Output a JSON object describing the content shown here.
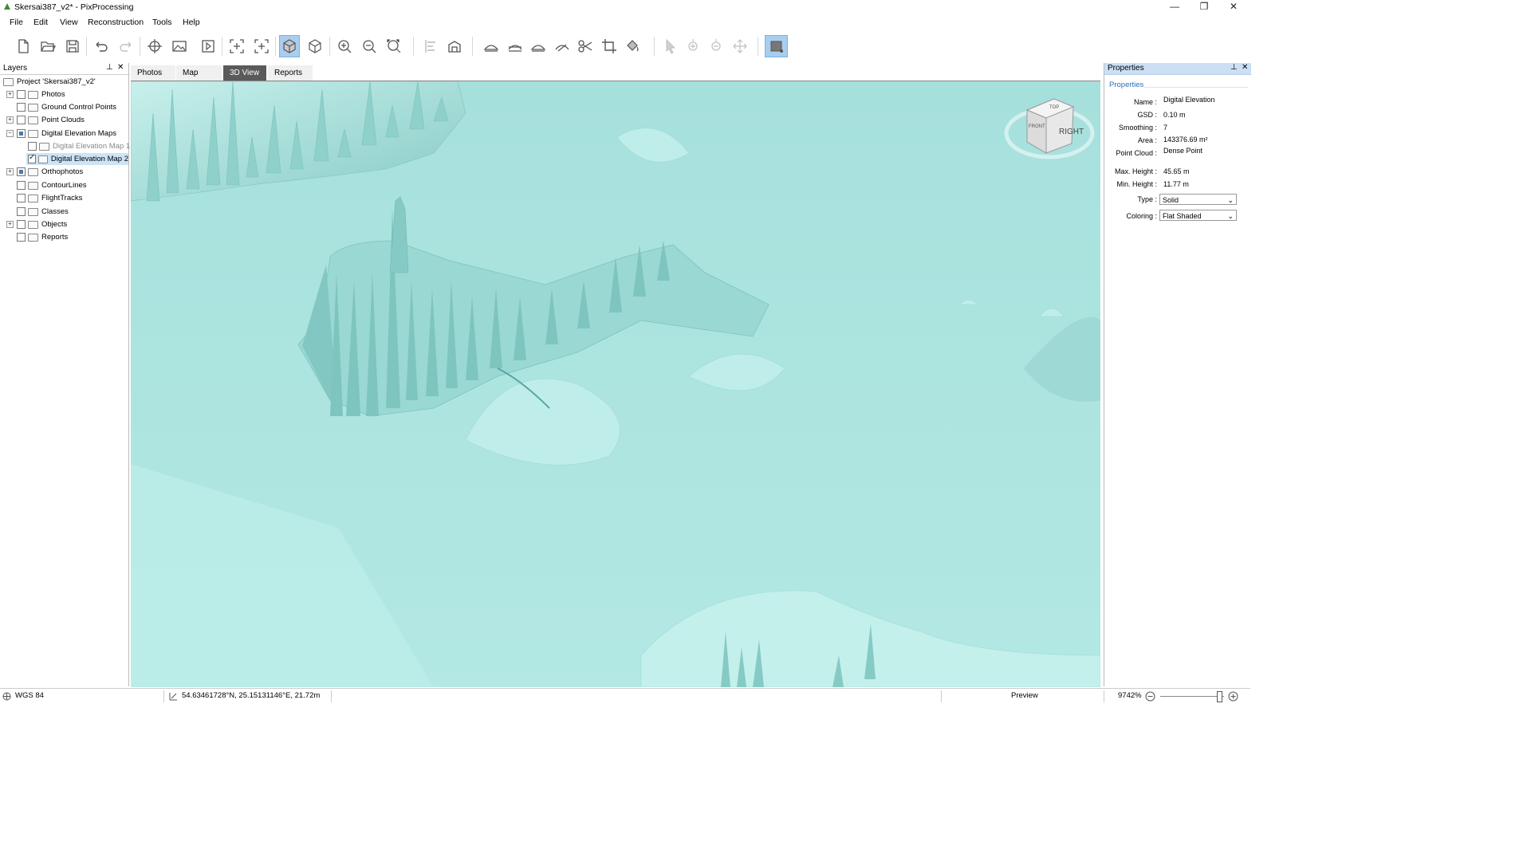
{
  "window": {
    "title": "Skersai387_v2* - PixProcessing",
    "minimize": "—",
    "maximize": "❐",
    "close": "✕"
  },
  "menu": [
    "File",
    "Edit",
    "View",
    "Reconstruction",
    "Tools",
    "Help"
  ],
  "toolbar_icons": [
    "new-file",
    "open-folder",
    "save",
    "undo",
    "redo",
    "gcp-target",
    "photo",
    "play",
    "select-add",
    "select-remove",
    "3d-solid",
    "3d-wireframe",
    "zoom-in",
    "zoom-out",
    "zoom-fit",
    "align",
    "volume",
    "surface-1",
    "surface-2",
    "surface-3",
    "surface-4",
    "scissors",
    "crop",
    "fill",
    "pointer",
    "point-add",
    "point-remove",
    "point-move",
    "render-toggle"
  ],
  "layers": {
    "title": "Layers",
    "pin": "⊥",
    "close": "✕",
    "project": "Project 'Skersai387_v2'",
    "items": [
      {
        "label": "Photos",
        "expander": "+",
        "check": "none"
      },
      {
        "label": "Ground Control Points",
        "expander": "",
        "check": "none"
      },
      {
        "label": "Point Clouds",
        "expander": "+",
        "check": "none"
      },
      {
        "label": "Digital Elevation Maps",
        "expander": "−",
        "check": "partial"
      },
      {
        "label": "Digital Elevation Map 1",
        "expander": "",
        "check": "none"
      },
      {
        "label": "Digital Elevation Map 2",
        "expander": "",
        "check": "checked"
      },
      {
        "label": "Orthophotos",
        "expander": "+",
        "check": "partial"
      },
      {
        "label": "ContourLines",
        "expander": "",
        "check": "none"
      },
      {
        "label": "FlightTracks",
        "expander": "",
        "check": "none"
      },
      {
        "label": "Classes",
        "expander": "",
        "check": "none"
      },
      {
        "label": "Objects",
        "expander": "+",
        "check": "none"
      },
      {
        "label": "Reports",
        "expander": "",
        "check": "none"
      }
    ]
  },
  "tabs": [
    {
      "label": "Photos",
      "active": false
    },
    {
      "label": "Map",
      "active": false
    },
    {
      "label": "3D View",
      "active": true
    },
    {
      "label": "Reports",
      "active": false
    }
  ],
  "viewcube": {
    "face": "RIGHT",
    "top": "TOP",
    "front": "FRONT"
  },
  "properties": {
    "title": "Properties",
    "section": "Properties",
    "rows": [
      {
        "label": "Name :",
        "value": "Digital Elevation"
      },
      {
        "label": "GSD :",
        "value": "0.10 m"
      },
      {
        "label": "Smoothing :",
        "value": "7"
      },
      {
        "label": "Area :",
        "value": "143376.69 m²"
      },
      {
        "label": "Point Cloud :",
        "value": "Dense Point"
      },
      {
        "label": "Max. Height :",
        "value": "45.65 m"
      },
      {
        "label": "Min. Height :",
        "value": "11.77 m"
      }
    ],
    "type_label": "Type :",
    "type_value": "Solid",
    "coloring_label": "Coloring :",
    "coloring_value": "Flat Shaded"
  },
  "status": {
    "crs": "WGS 84",
    "coords": "54.63461728°N, 25.15131146°E, 21.72m",
    "mode": "Preview",
    "zoom": "9742%"
  },
  "colors": {
    "terrain": "#aee5e1",
    "terrain_shadow": "#7fc8c3",
    "terrain_highlight": "#cdf2ee",
    "selection": "#cce4f7",
    "accent": "#a9cdee"
  }
}
